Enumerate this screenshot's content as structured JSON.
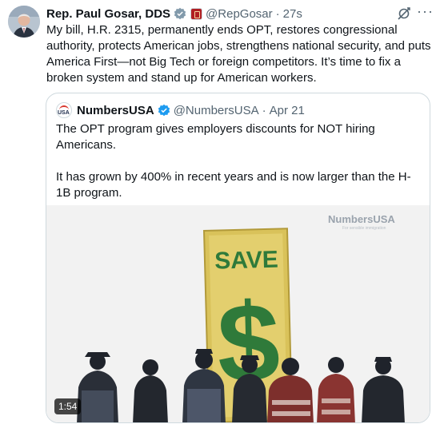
{
  "tweet": {
    "author": {
      "display_name": "Rep. Paul Gosar, DDS",
      "handle": "@RepGosar",
      "separator": "·",
      "time": "27s",
      "verified_icon": "gray-verified-badge-icon",
      "affiliation_icon": "government-affiliation-badge-icon"
    },
    "text": "My bill, H.R. 2315, permanently ends OPT, restores congressional authority, protects American jobs, strengthens national security, and puts America First—not Big Tech or foreign competitors. It’s time to fix a broken system and stand up for American workers.",
    "icons": {
      "grok": "grok-icon",
      "more": "more-options-icon"
    },
    "more_glyph": "···"
  },
  "quote": {
    "author": {
      "display_name": "NumbersUSA",
      "handle": "@NumbersUSA",
      "separator": "·",
      "time": "Apr 21",
      "verified_icon": "blue-verified-badge-icon",
      "avatar_text": "USA"
    },
    "paragraphs": [
      "The OPT program gives employers discounts for NOT hiring Americans.",
      "It has grown by 400% in recent years and is now larger than the H-1B program.",
      "..."
    ],
    "media": {
      "type": "video",
      "duration": "1:54",
      "sign_word": "SAVE",
      "sign_symbol": "$",
      "watermark": "NumbersUSA",
      "watermark_tagline": "For sensible immigration",
      "colors": {
        "sign_fill": "#d9c25a",
        "sign_text": "#2f7a3a",
        "background": "#f2f2f2"
      }
    }
  },
  "colors": {
    "text_primary": "#0f1419",
    "text_secondary": "#536471",
    "border": "#cfd9de",
    "verified_blue": "#1d9bf0",
    "verified_gray": "#829aab"
  }
}
